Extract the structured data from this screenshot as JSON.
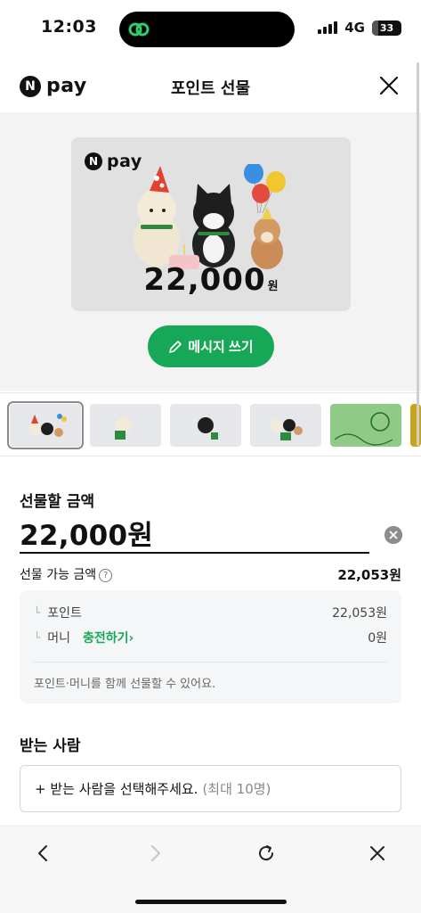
{
  "status_bar": {
    "time": "12:03",
    "network": "4G",
    "battery": "33"
  },
  "header": {
    "logo_letter": "N",
    "logo_text": "pay",
    "title": "포인트 선물"
  },
  "card": {
    "logo_letter": "N",
    "logo_text": "pay",
    "amount": "22,000",
    "currency": "원"
  },
  "message_button": {
    "label": "메시지 쓰기"
  },
  "thumbnails": {
    "count": 5,
    "selected_index": 0
  },
  "amount_section": {
    "label": "선물할 금액",
    "value": "22,000원"
  },
  "available": {
    "label": "선물 가능 금액",
    "help": "?",
    "value": "22,053원"
  },
  "breakdown": {
    "points_label": "포인트",
    "points_value": "22,053원",
    "money_label": "머니",
    "charge_link": "충전하기",
    "money_value": "0원",
    "note": "포인트·머니를 함께 선물할 수 있어요."
  },
  "recipient": {
    "label": "받는 사람",
    "button_text": "+ 받는 사람을 선택해주세요.",
    "max_text": "(최대 10명)"
  },
  "colors": {
    "accent": "#17a857",
    "card_bg": "#e1e1e2",
    "hero_bg": "#f3f3f4"
  }
}
